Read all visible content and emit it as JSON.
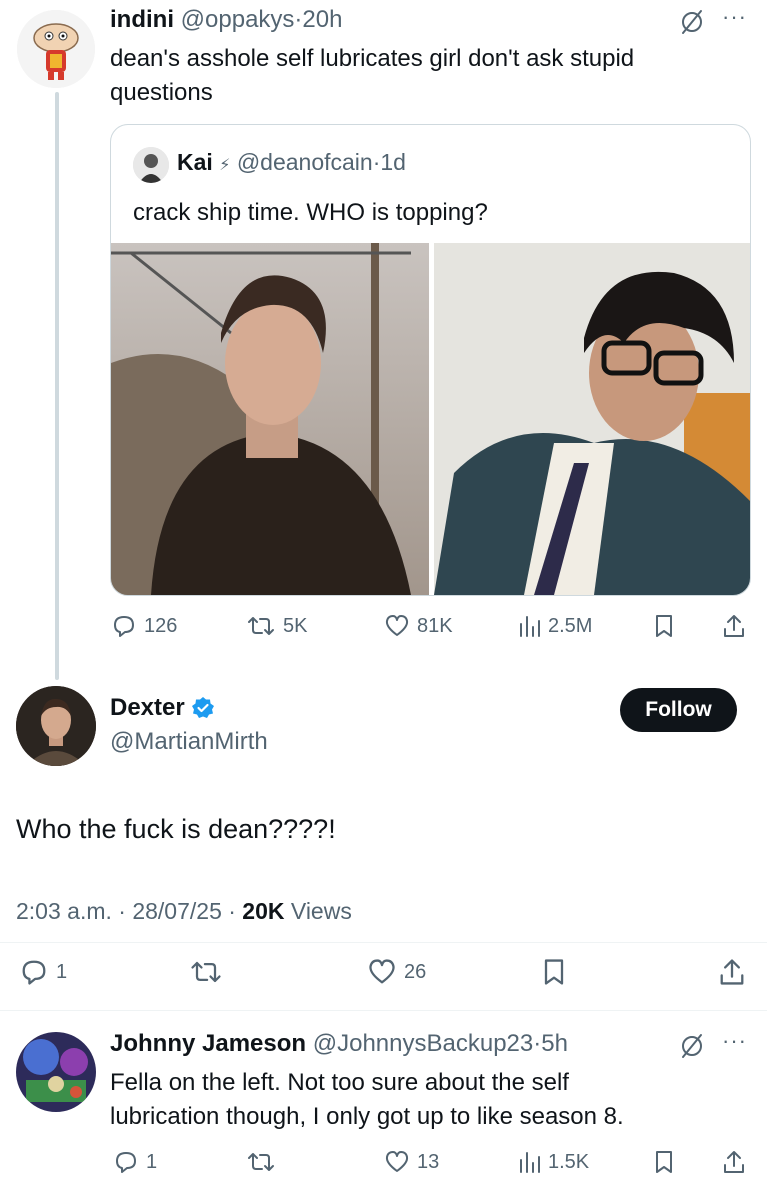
{
  "tweet1": {
    "display_name": "indini",
    "handle": "@oppakys",
    "sep": "·",
    "time": "20h",
    "text_line1": "dean's asshole self lubricates girl don't ask stupid",
    "text_line2": "questions",
    "avatar_icon": "cartoon-baby-avatar",
    "quote": {
      "display_name": "Kai",
      "badge": "⚡",
      "handle": "@deanofcain",
      "sep": "·",
      "time": "1d",
      "text": "crack ship time. WHO is topping?"
    },
    "stats": {
      "replies": "126",
      "reposts": "5K",
      "likes": "81K",
      "views": "2.5M"
    }
  },
  "main_tweet": {
    "display_name": "Dexter",
    "handle": "@MartianMirth",
    "follow_label": "Follow",
    "text": "Who the fuck is dean????!",
    "timestamp": "2:03 a.m. · 28/07/25 · ",
    "views_count": "20K",
    "views_label": " Views",
    "stats": {
      "replies": "1",
      "likes": "26"
    },
    "verified_color": "#1d9bf0"
  },
  "reply": {
    "display_name": "Johnny Jameson",
    "handle": "@JohnnysBackup23",
    "sep": "·",
    "time": "5h",
    "text_line1": "Fella on the left. Not too sure about the self",
    "text_line2": "lubrication though, I only got up to like season 8.",
    "stats": {
      "replies": "1",
      "likes": "13",
      "views": "1.5K"
    }
  }
}
